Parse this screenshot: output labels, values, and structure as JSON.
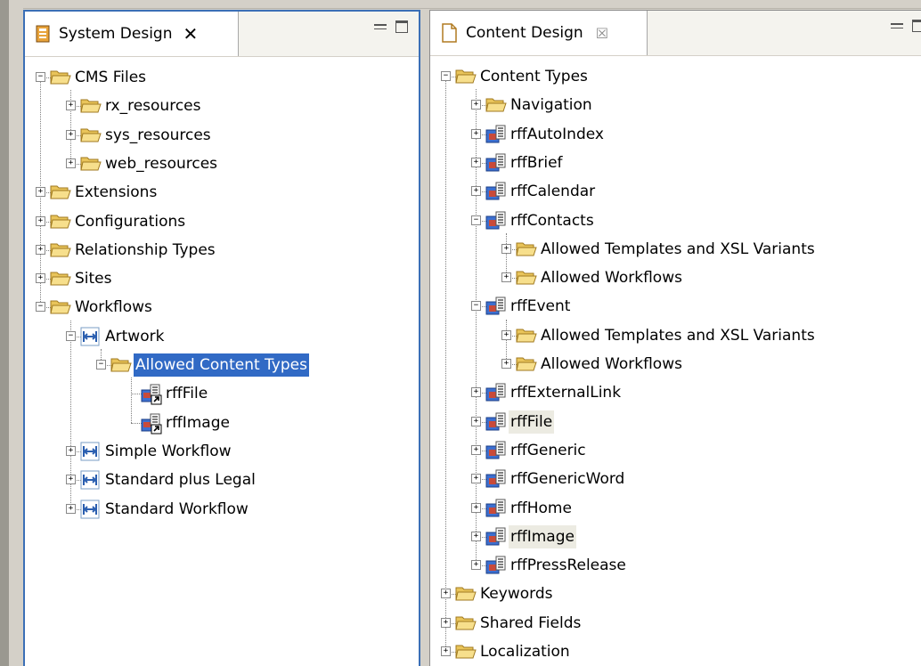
{
  "left_panel": {
    "tab_title": "System Design",
    "tree": [
      {
        "label": "CMS Files",
        "icon": "folder-icon",
        "toggle": "−",
        "depth": 0
      },
      {
        "label": "rx_resources",
        "icon": "folder-icon",
        "toggle": "+",
        "depth": 1
      },
      {
        "label": "sys_resources",
        "icon": "folder-icon",
        "toggle": "+",
        "depth": 1
      },
      {
        "label": "web_resources",
        "icon": "folder-icon",
        "toggle": "+",
        "depth": 1
      },
      {
        "label": "Extensions",
        "icon": "folder-icon",
        "toggle": "+",
        "depth": 0
      },
      {
        "label": "Configurations",
        "icon": "folder-icon",
        "toggle": "+",
        "depth": 0
      },
      {
        "label": "Relationship Types",
        "icon": "folder-icon",
        "toggle": "+",
        "depth": 0
      },
      {
        "label": "Sites",
        "icon": "folder-icon",
        "toggle": "+",
        "depth": 0
      },
      {
        "label": "Workflows",
        "icon": "folder-icon",
        "toggle": "−",
        "depth": 0
      },
      {
        "label": "Artwork",
        "icon": "workflow-icon",
        "toggle": "−",
        "depth": 1
      },
      {
        "label": "Allowed Content Types",
        "icon": "folder-icon",
        "toggle": "−",
        "depth": 2,
        "selected": true
      },
      {
        "label": "rffFile",
        "icon": "content-type-link-icon",
        "toggle": "",
        "depth": 3
      },
      {
        "label": "rffImage",
        "icon": "content-type-link-icon",
        "toggle": "",
        "depth": 3
      },
      {
        "label": "Simple Workflow",
        "icon": "workflow-icon",
        "toggle": "+",
        "depth": 1
      },
      {
        "label": "Standard plus Legal",
        "icon": "workflow-icon",
        "toggle": "+",
        "depth": 1
      },
      {
        "label": "Standard Workflow",
        "icon": "workflow-icon",
        "toggle": "+",
        "depth": 1
      }
    ]
  },
  "right_panel": {
    "tab_title": "Content Design",
    "tree": [
      {
        "label": "Content Types",
        "icon": "folder-icon",
        "toggle": "−",
        "depth": 0
      },
      {
        "label": "Navigation",
        "icon": "folder-icon",
        "toggle": "+",
        "depth": 1
      },
      {
        "label": "rffAutoIndex",
        "icon": "content-type-icon",
        "toggle": "+",
        "depth": 1
      },
      {
        "label": "rffBrief",
        "icon": "content-type-icon",
        "toggle": "+",
        "depth": 1
      },
      {
        "label": "rffCalendar",
        "icon": "content-type-icon",
        "toggle": "+",
        "depth": 1
      },
      {
        "label": "rffContacts",
        "icon": "content-type-icon",
        "toggle": "−",
        "depth": 1
      },
      {
        "label": "Allowed Templates and XSL Variants",
        "icon": "folder-icon",
        "toggle": "+",
        "depth": 2
      },
      {
        "label": "Allowed Workflows",
        "icon": "folder-icon",
        "toggle": "+",
        "depth": 2
      },
      {
        "label": "rffEvent",
        "icon": "content-type-icon",
        "toggle": "−",
        "depth": 1
      },
      {
        "label": "Allowed Templates and XSL Variants",
        "icon": "folder-icon",
        "toggle": "+",
        "depth": 2
      },
      {
        "label": "Allowed Workflows",
        "icon": "folder-icon",
        "toggle": "+",
        "depth": 2
      },
      {
        "label": "rffExternalLink",
        "icon": "content-type-icon",
        "toggle": "+",
        "depth": 1
      },
      {
        "label": "rffFile",
        "icon": "content-type-icon",
        "toggle": "+",
        "depth": 1,
        "highlighted": true
      },
      {
        "label": "rffGeneric",
        "icon": "content-type-icon",
        "toggle": "+",
        "depth": 1
      },
      {
        "label": "rffGenericWord",
        "icon": "content-type-icon",
        "toggle": "+",
        "depth": 1
      },
      {
        "label": "rffHome",
        "icon": "content-type-icon",
        "toggle": "+",
        "depth": 1
      },
      {
        "label": "rffImage",
        "icon": "content-type-icon",
        "toggle": "+",
        "depth": 1,
        "highlighted": true
      },
      {
        "label": "rffPressRelease",
        "icon": "content-type-icon",
        "toggle": "+",
        "depth": 1
      },
      {
        "label": "Keywords",
        "icon": "folder-icon",
        "toggle": "+",
        "depth": 0
      },
      {
        "label": "Shared Fields",
        "icon": "folder-icon",
        "toggle": "+",
        "depth": 0
      },
      {
        "label": "Localization",
        "icon": "folder-icon",
        "toggle": "+",
        "depth": 0
      }
    ]
  },
  "colors": {
    "selection": "#316ac5",
    "active_border": "#3b6fb6",
    "folder_fill": "#f5d97a",
    "highlight": "#ecebe2"
  }
}
